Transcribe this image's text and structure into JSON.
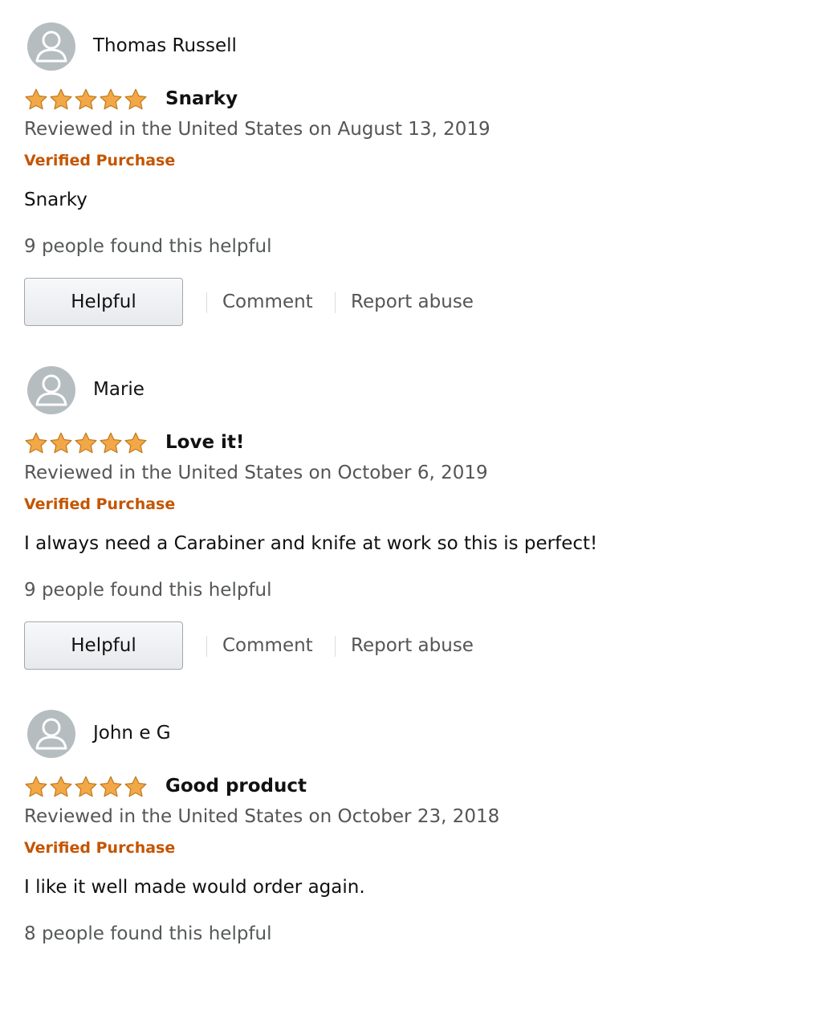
{
  "colors": {
    "star": "#f3a847",
    "verified": "#c45500",
    "meta_text": "#555555",
    "avatar_bg": "#b6bdc1"
  },
  "icons": {
    "avatar": "default-user-icon",
    "star": "star-icon"
  },
  "reviews": [
    {
      "reviewer": "Thomas Russell",
      "rating": 5,
      "title": "Snarky",
      "date": "Reviewed in the United States on August 13, 2019",
      "verified": "Verified Purchase",
      "body": "Snarky",
      "helpful_count": "9 people found this helpful",
      "helpful_label": "Helpful",
      "comment_label": "Comment",
      "report_label": "Report abuse"
    },
    {
      "reviewer": "Marie",
      "rating": 5,
      "title": "Love it!",
      "date": "Reviewed in the United States on October 6, 2019",
      "verified": "Verified Purchase",
      "body": "I always need a Carabiner and knife at work so this is perfect!",
      "helpful_count": "9 people found this helpful",
      "helpful_label": "Helpful",
      "comment_label": "Comment",
      "report_label": "Report abuse"
    },
    {
      "reviewer": "John e G",
      "rating": 5,
      "title": "Good product",
      "date": "Reviewed in the United States on October 23, 2018",
      "verified": "Verified Purchase",
      "body": "I like it well made would order again.",
      "helpful_count": "8 people found this helpful"
    }
  ]
}
